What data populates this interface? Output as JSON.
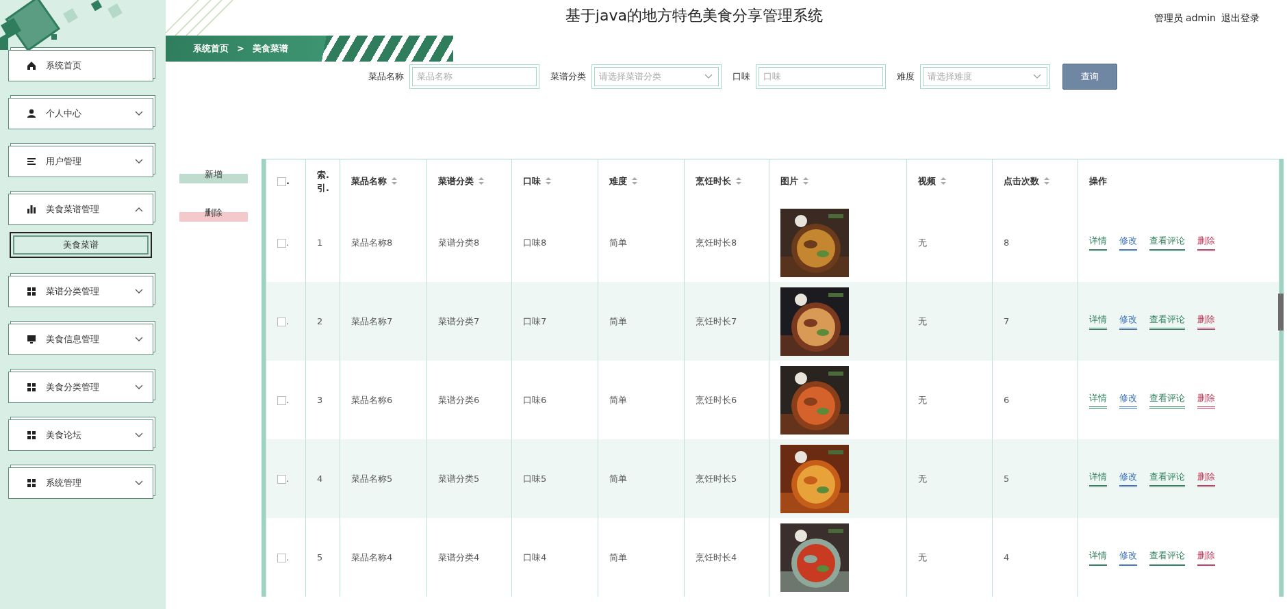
{
  "header": {
    "title": "基于java的地方特色美食分享管理系统",
    "user": "管理员 admin",
    "logout": "退出登录"
  },
  "breadcrumb": {
    "items": [
      "系统首页",
      "美食菜谱"
    ],
    "separator": ">"
  },
  "sidebar": {
    "items": [
      {
        "label": "系统首页"
      },
      {
        "label": "个人中心",
        "expanded": false
      },
      {
        "label": "用户管理",
        "expanded": false
      },
      {
        "label": "美食菜谱管理",
        "expanded": true,
        "children": [
          {
            "label": "美食菜谱",
            "selected": true
          }
        ]
      },
      {
        "label": "菜谱分类管理",
        "expanded": false
      },
      {
        "label": "美食信息管理",
        "expanded": false
      },
      {
        "label": "美食分类管理",
        "expanded": false
      },
      {
        "label": "美食论坛",
        "expanded": false
      },
      {
        "label": "系统管理",
        "expanded": false
      }
    ]
  },
  "search": {
    "fields": [
      {
        "label": "菜品名称",
        "placeholder": "菜品名称",
        "kind": "text"
      },
      {
        "label": "菜谱分类",
        "placeholder": "请选择菜谱分类",
        "kind": "select"
      },
      {
        "label": "口味",
        "placeholder": "口味",
        "kind": "text"
      },
      {
        "label": "难度",
        "placeholder": "请选择难度",
        "kind": "select"
      }
    ],
    "button": "查询"
  },
  "actions": [
    {
      "label": "新增",
      "kind": "add"
    },
    {
      "label": "删除",
      "kind": "delete"
    }
  ],
  "table": {
    "columns": [
      {
        "label": ".",
        "kind": "checkbox",
        "checked": false
      },
      {
        "label": "索.\n引.",
        "sortable": false
      },
      {
        "label": "菜品名称",
        "sortable": true
      },
      {
        "label": "菜谱分类",
        "sortable": true
      },
      {
        "label": "口味",
        "sortable": true
      },
      {
        "label": "难度",
        "sortable": true
      },
      {
        "label": "烹饪时长",
        "sortable": true
      },
      {
        "label": "图片",
        "sortable": true
      },
      {
        "label": "视频",
        "sortable": true
      },
      {
        "label": "点击次数",
        "sortable": true
      },
      {
        "label": "操作",
        "sortable": false
      }
    ],
    "rows": [
      {
        "checked": false,
        "mark": ".",
        "index": "1",
        "name": "菜品名称8",
        "category": "菜谱分类8",
        "taste": "口味8",
        "difficulty": "简单",
        "time": "烹饪时长8",
        "picture": {
          "kind": "picture"
        },
        "video": "无",
        "clicks": "8",
        "ops": [
          {
            "label": "详情",
            "color": "#2e7d5b"
          },
          {
            "label": "修改",
            "color": "#3a6fc4"
          },
          {
            "label": "查看评论",
            "color": "#2e7d5b"
          },
          {
            "label": "删除",
            "color": "#c0395a"
          }
        ]
      },
      {
        "checked": false,
        "mark": ".",
        "index": "2",
        "name": "菜品名称7",
        "category": "菜谱分类7",
        "taste": "口味7",
        "difficulty": "简单",
        "time": "烹饪时长7",
        "picture": {
          "kind": "picture"
        },
        "video": "无",
        "clicks": "7",
        "ops": [
          {
            "label": "详情",
            "color": "#2e7d5b"
          },
          {
            "label": "修改",
            "color": "#3a6fc4"
          },
          {
            "label": "查看评论",
            "color": "#2e7d5b"
          },
          {
            "label": "删除",
            "color": "#c0395a"
          }
        ]
      },
      {
        "checked": false,
        "mark": ".",
        "index": "3",
        "name": "菜品名称6",
        "category": "菜谱分类6",
        "taste": "口味6",
        "difficulty": "简单",
        "time": "烹饪时长6",
        "picture": {
          "kind": "picture"
        },
        "video": "无",
        "clicks": "6",
        "ops": [
          {
            "label": "详情",
            "color": "#2e7d5b"
          },
          {
            "label": "修改",
            "color": "#3a6fc4"
          },
          {
            "label": "查看评论",
            "color": "#2e7d5b"
          },
          {
            "label": "删除",
            "color": "#c0395a"
          }
        ]
      },
      {
        "checked": false,
        "mark": ".",
        "index": "4",
        "name": "菜品名称5",
        "category": "菜谱分类5",
        "taste": "口味5",
        "difficulty": "简单",
        "time": "烹饪时长5",
        "picture": {
          "kind": "picture"
        },
        "video": "无",
        "clicks": "5",
        "ops": [
          {
            "label": "详情",
            "color": "#2e7d5b"
          },
          {
            "label": "修改",
            "color": "#3a6fc4"
          },
          {
            "label": "查看评论",
            "color": "#2e7d5b"
          },
          {
            "label": "删除",
            "color": "#c0395a"
          }
        ]
      },
      {
        "checked": false,
        "mark": ".",
        "index": "5",
        "name": "菜品名称4",
        "category": "菜谱分类4",
        "taste": "口味4",
        "difficulty": "简单",
        "time": "烹饪时长4",
        "picture": {
          "kind": "picture"
        },
        "video": "无",
        "clicks": "4",
        "ops": [
          {
            "label": "详情",
            "color": "#2e7d5b"
          },
          {
            "label": "修改",
            "color": "#3a6fc4"
          },
          {
            "label": "查看评论",
            "color": "#2e7d5b"
          },
          {
            "label": "删除",
            "color": "#c0395a"
          }
        ]
      }
    ]
  }
}
